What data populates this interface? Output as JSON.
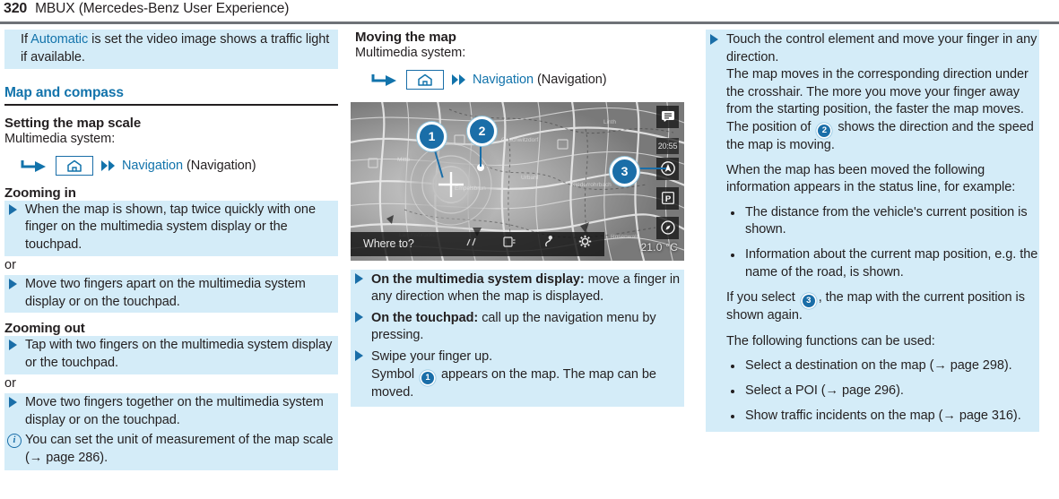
{
  "header": {
    "page_number": "320",
    "chapter": "MBUX (Mercedes-Benz User Experience)"
  },
  "column_left": {
    "intro": {
      "text_before": "If ",
      "link": "Automatic",
      "text_after": " is set the video image shows a traffic light if available."
    },
    "section_heading": "Map and compass",
    "sub_heading_1": "Setting the map scale",
    "system_label": "Multimedia system:",
    "nav_path": {
      "home_icon": "home-icon",
      "arrow_icon": "hook-arrow-icon",
      "double_arrow_icon": "double-chevron-right-icon",
      "label": "Navigation",
      "parenthetical": "(Navigation)"
    },
    "sub_heading_2": "Zooming in",
    "step_1": "When the map is shown, tap twice quickly with one finger on the multimedia system display or the touchpad.",
    "or_1": "or",
    "step_2": "Move two fingers apart on the multimedia system display or on the touchpad.",
    "sub_heading_3": "Zooming out",
    "step_3": "Tap with two fingers on the multimedia system display or the touchpad.",
    "or_2": "or",
    "step_4": "Move two fingers together on the multimedia system display or on the touchpad.",
    "note": "You can set the unit of measurement of the map scale (→ page 286)."
  },
  "column_middle": {
    "sub_heading_1": "Moving the map",
    "system_label": "Multimedia system:",
    "nav_path": {
      "home_icon": "home-icon",
      "arrow_icon": "hook-arrow-icon",
      "double_arrow_icon": "double-chevron-right-icon",
      "label": "Navigation",
      "parenthetical": "(Navigation)"
    },
    "figure": {
      "name": "navigation-map-screenshot",
      "bottom_bar": {
        "where_to_label": "Where to?",
        "icons": [
          "route-icon",
          "traffic-icon",
          "poi-pin-icon",
          "settings-gear-icon"
        ]
      },
      "temperature": "21.0 °C",
      "clock": "20:55",
      "side_buttons": [
        "list-menu-icon",
        "navigation-arrow-icon",
        "parking-icon",
        "compass-icon"
      ],
      "callouts": [
        {
          "number": "1",
          "meaning": "crosshair-marker"
        },
        {
          "number": "2",
          "meaning": "movement-dot-marker"
        },
        {
          "number": "3",
          "meaning": "current-position-button"
        }
      ]
    },
    "step_1_bold": "On the multimedia system display:",
    "step_1_rest": " move a finger in any direction when the map is displayed.",
    "step_2_bold": "On the touchpad:",
    "step_2_rest": " call up the navigation menu by pressing.",
    "step_3_line1": "Swipe your finger up.",
    "step_3_line2_before": "Symbol ",
    "step_3_token": "1",
    "step_3_line2_after": " appears on the map. The map can be moved."
  },
  "column_right": {
    "step_1_line1": "Touch the control element and move your finger in any direction.",
    "step_1_line2_before": "The map moves in the corresponding direction under the crosshair. The more you move your finger away from the starting position, the faster the map moves. The position of ",
    "step_1_token": "2",
    "step_1_line2_after": " shows the direction and the speed the map is moving.",
    "para_1": "When the map has been moved the following information appears in the status line, for example:",
    "bullets_1": [
      "The distance from the vehicle's current position is shown.",
      "Information about the current map position, e.g. the name of the road, is shown."
    ],
    "para_2_before": "If you select ",
    "para_2_token": "3",
    "para_2_after": ", the map with the current position is shown again.",
    "para_3": "The following functions can be used:",
    "bullets_2": [
      "Select a destination on the map (→ page 298).",
      "Select a POI (→ page 296).",
      "Show traffic incidents on the map (→ page 316)."
    ]
  },
  "colors": {
    "accent_blue": "#1273ab",
    "band_blue": "#d4ecf8",
    "marker_blue": "#1a6ea8",
    "rule_gray": "#6f7277",
    "text": "#231f20"
  }
}
